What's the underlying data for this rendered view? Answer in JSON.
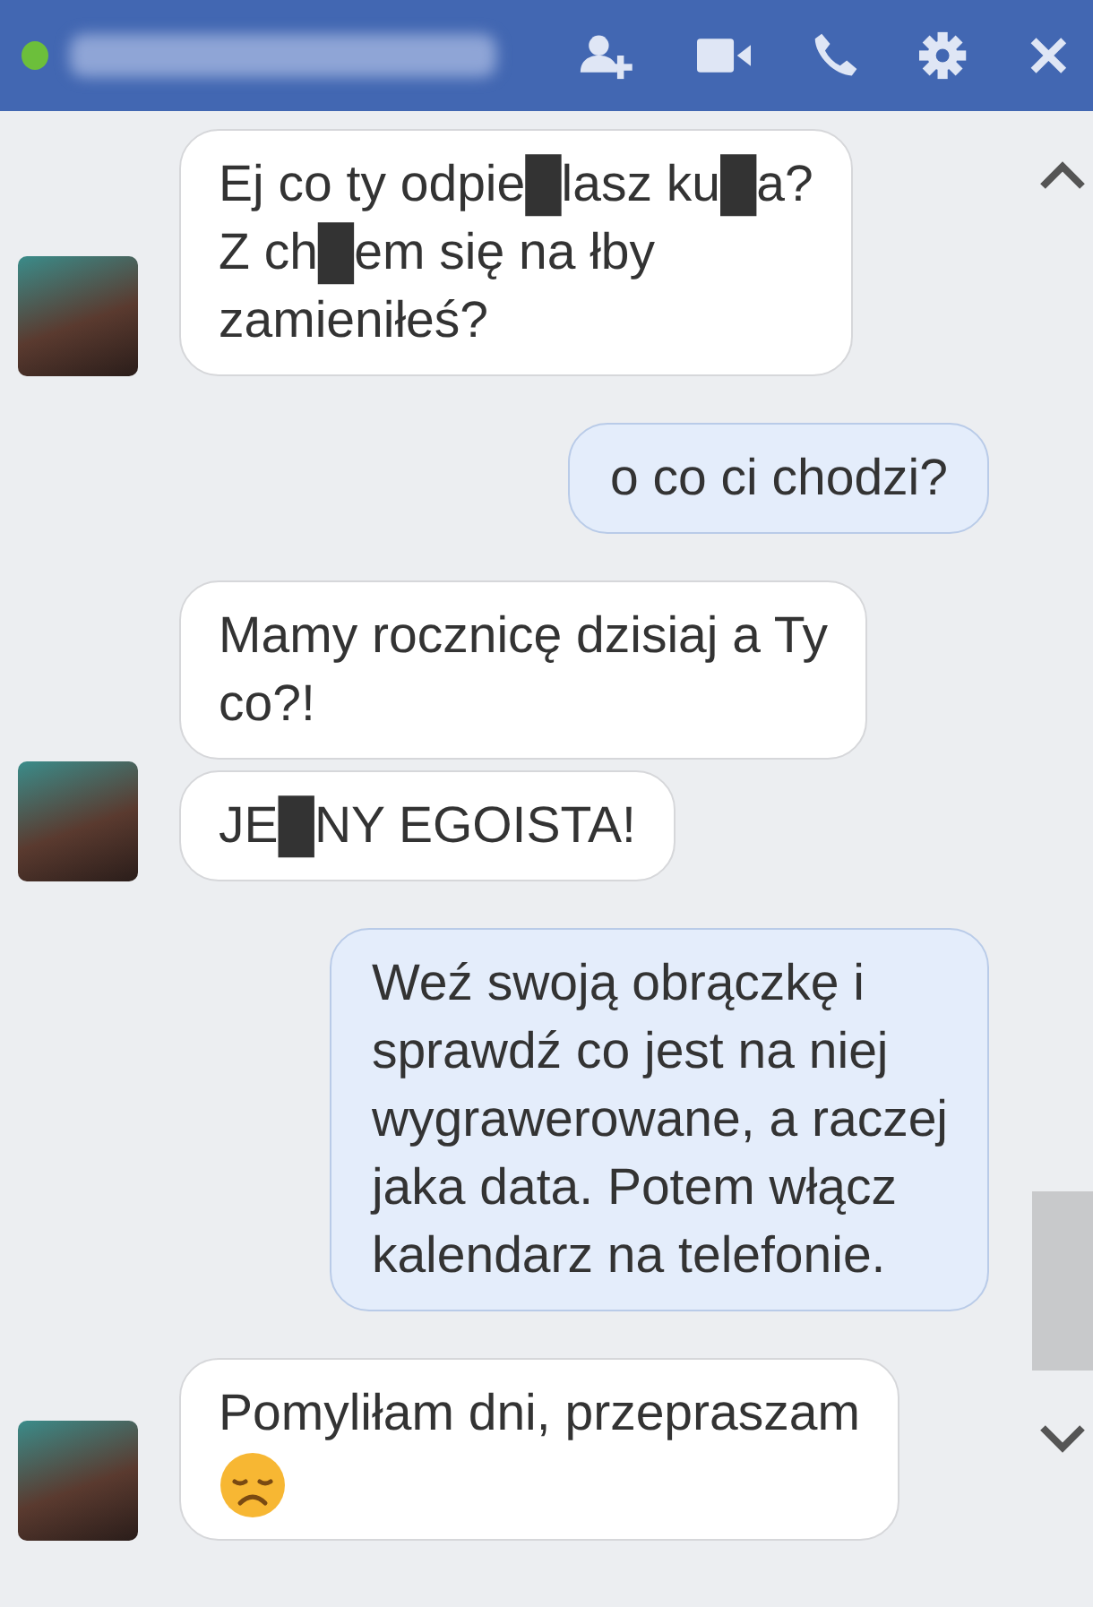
{
  "header": {
    "online": true
  },
  "messages": [
    {
      "kind": "incoming",
      "bubbles": [
        {
          "lines": [
            "Ej co ty odpie█lasz ku█a?",
            "Z ch█em się na łby",
            "zamieniłeś?"
          ]
        }
      ]
    },
    {
      "kind": "outgoing",
      "bubbles": [
        {
          "lines": [
            "o co ci chodzi?"
          ]
        }
      ]
    },
    {
      "kind": "incoming",
      "bubbles": [
        {
          "lines": [
            "Mamy rocznicę dzisiaj a Ty",
            "co?!"
          ]
        },
        {
          "lines": [
            "JE█NY EGOISTA!"
          ]
        }
      ]
    },
    {
      "kind": "outgoing",
      "bubbles": [
        {
          "lines": [
            "Weź swoją obrączkę i",
            "sprawdź co jest na niej",
            "wygrawerowane, a raczej",
            "jaka data. Potem włącz",
            "kalendarz na telefonie."
          ]
        }
      ]
    },
    {
      "kind": "incoming",
      "bubbles": [
        {
          "lines": [
            "Pomyliłam dni, przepraszam"
          ],
          "sad_emoji": true
        }
      ]
    }
  ]
}
